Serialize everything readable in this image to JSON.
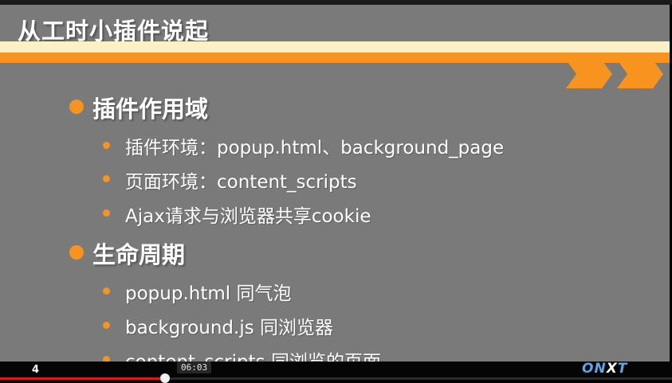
{
  "slide": {
    "title": "从工时小插件说起",
    "sections": [
      {
        "heading": "插件作用域",
        "items": [
          "插件环境：popup.html、background_page",
          "页面环境：content_scripts",
          "Ajax请求与浏览器共享cookie"
        ]
      },
      {
        "heading": "生命周期",
        "items": [
          "popup.html 同气泡",
          "background.js 同浏览器",
          "content_scripts 同浏览的页面"
        ]
      }
    ]
  },
  "player": {
    "page_number": "4",
    "current_time": "06:03",
    "progress_fraction": 0.245,
    "brand_prefix": "ON",
    "brand_x": "X",
    "brand_suffix": "T"
  },
  "colors": {
    "slide_background": "#7a7a7a",
    "accent_orange": "#f7931e",
    "band_cream": "#fbf1c7",
    "progress_red": "#e4141c"
  }
}
